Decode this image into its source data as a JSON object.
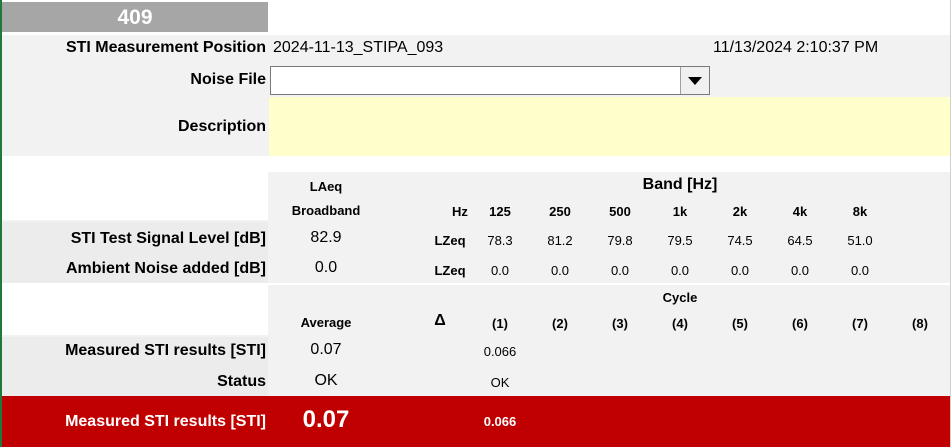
{
  "header": {
    "id_number": "409",
    "position_label": "STI Measurement Position",
    "position_value": "2024-11-13_STIPA_093",
    "timestamp": "11/13/2024 2:10:37 PM",
    "noise_file_label": "Noise File",
    "noise_file_value": "",
    "description_label": "Description",
    "description_value": ""
  },
  "levels": {
    "laeq_header": "LAeq",
    "broadband_header": "Broadband",
    "band_header": "Band [Hz]",
    "hz_label": "Hz",
    "bands": [
      "125",
      "250",
      "500",
      "1k",
      "2k",
      "4k",
      "8k"
    ],
    "signal_row": {
      "label": "STI Test Signal Level [dB]",
      "broadband": "82.9",
      "unit": "LZeq",
      "values": [
        "78.3",
        "81.2",
        "79.8",
        "79.5",
        "74.5",
        "64.5",
        "51.0"
      ]
    },
    "noise_row": {
      "label": "Ambient Noise added [dB]",
      "broadband": "0.0",
      "unit": "LZeq",
      "values": [
        "0.0",
        "0.0",
        "0.0",
        "0.0",
        "0.0",
        "0.0",
        "0.0"
      ]
    }
  },
  "results": {
    "cycle_header": "Cycle",
    "average_header": "Average",
    "delta_header": "Δ",
    "cycles": [
      "(1)",
      "(2)",
      "(3)",
      "(4)",
      "(5)",
      "(6)",
      "(7)",
      "(8)"
    ],
    "measured_label": "Measured STI results [STI]",
    "measured_average": "0.07",
    "measured_cycle_1": "0.066",
    "status_label": "Status",
    "status_average": "OK",
    "status_cycle_1": "OK"
  },
  "summary": {
    "label": "Measured STI results [STI]",
    "average": "0.07",
    "cycle_1": "0.066",
    "bar_color": "#c00000"
  }
}
